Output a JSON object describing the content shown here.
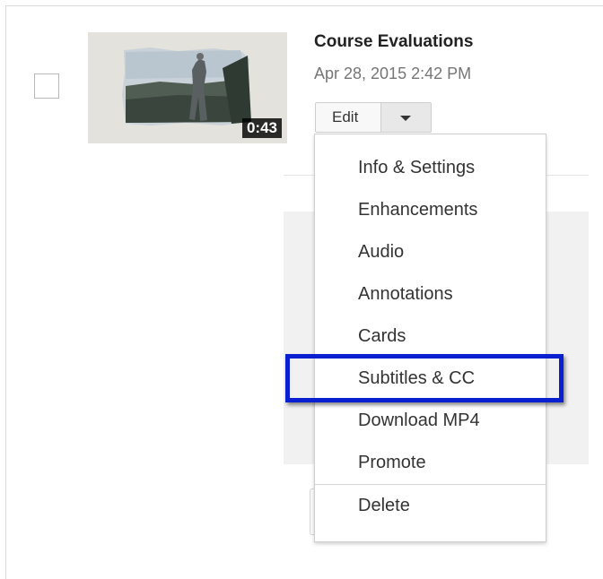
{
  "video": {
    "title": "Course Evaluations",
    "date": "Apr 28, 2015 2:42 PM",
    "duration": "0:43"
  },
  "actions": {
    "edit_label": "Edit"
  },
  "menu": {
    "items": [
      {
        "label": "Info & Settings"
      },
      {
        "label": "Enhancements"
      },
      {
        "label": "Audio"
      },
      {
        "label": "Annotations"
      },
      {
        "label": "Cards"
      },
      {
        "label": "Subtitles & CC"
      },
      {
        "label": "Download MP4"
      },
      {
        "label": "Promote"
      },
      {
        "label": "Delete"
      }
    ],
    "highlighted": "Subtitles & CC"
  },
  "colors": {
    "highlight_border": "#0a1fd0",
    "menu_border": "#cfcfcf",
    "date_text": "#767676"
  },
  "icons": {
    "dropdown": "caret-down-icon"
  }
}
